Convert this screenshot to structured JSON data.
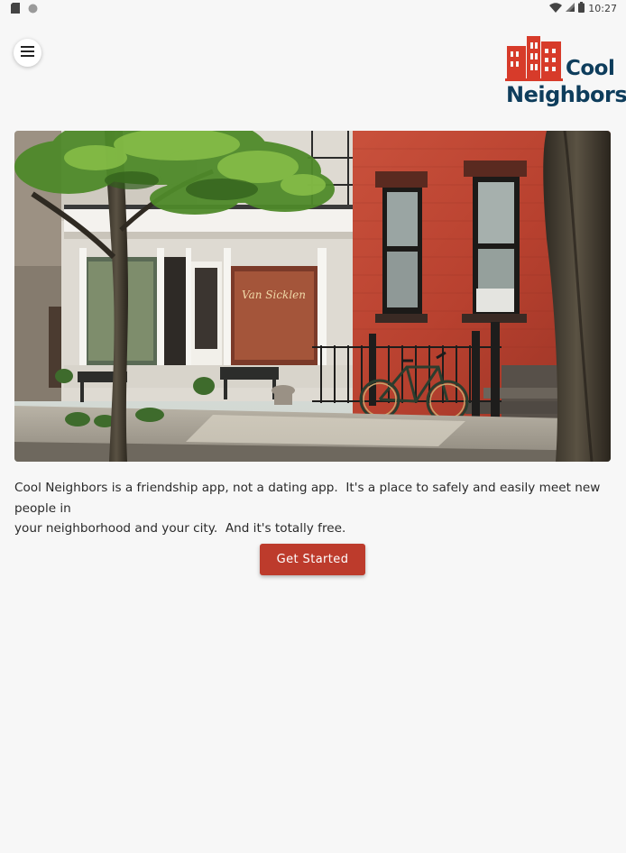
{
  "status_bar": {
    "time": "10:27",
    "icons": [
      "sd-card-icon",
      "circle-icon",
      "wifi-icon",
      "cell-signal-icon",
      "battery-icon"
    ]
  },
  "header": {
    "menu_icon": "hamburger-menu-icon",
    "logo": {
      "line1": "Cool",
      "line2": "Neighbors",
      "colors": {
        "icon": "#d73b2a",
        "text": "#0e3d5c"
      }
    }
  },
  "hero": {
    "icon": "street-photo",
    "sign_text": "Van Sicklen"
  },
  "main": {
    "description": "Cool Neighbors is a friendship app, not a dating app.  It's a place to safely and easily meet new people in\nyour neighborhood and your city.  And it's totally free.",
    "cta_label": "Get Started"
  },
  "colors": {
    "background": "#f7f7f7",
    "accent": "#bd3b2c",
    "brand_dark": "#0e3d5c"
  }
}
